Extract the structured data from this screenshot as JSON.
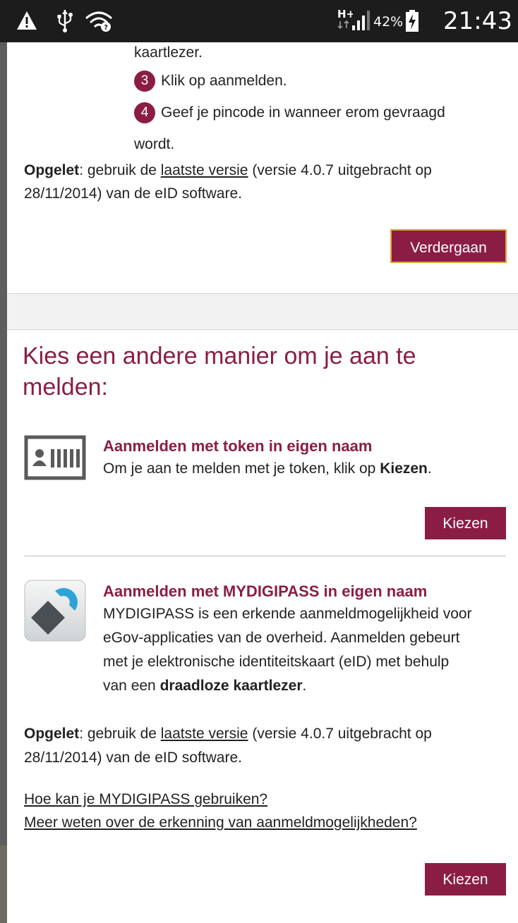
{
  "statusbar": {
    "icons": [
      "warning-icon",
      "usb-icon",
      "wifi-icon",
      "network-hplus-icon",
      "signal-icon",
      "battery-charging-icon"
    ],
    "network_type": "H+",
    "battery_percent": "42%",
    "time": "21:43"
  },
  "eid_section": {
    "step_cont_text": "kaartlezer.",
    "steps": [
      {
        "number": "3",
        "text": "Klik op aanmelden."
      },
      {
        "number": "4",
        "text": "Geef je pincode in wanneer erom gevraagd",
        "text_cont": "wordt."
      }
    ],
    "warning": {
      "label": "Opgelet",
      "text_before_link": ": gebruik de ",
      "link": "laatste versie",
      "text_after_link": " (versie 4.0.7 uitgebracht op",
      "text_line2": "28/11/2014) van de eID software."
    },
    "continue_button": "Verdergaan"
  },
  "other_methods": {
    "heading_line1": "Kies een andere manier om je aan te",
    "heading_line2": "melden:",
    "options": [
      {
        "icon": "id-card-icon",
        "title": "Aanmelden met token in eigen naam",
        "text_before": "Om je aan te melden met je token, klik op ",
        "text_bold": "Kiezen",
        "text_after": ".",
        "button": "Kiezen"
      },
      {
        "icon": "mydigipass-icon",
        "title": "Aanmelden met MYDIGIPASS in eigen naam",
        "lines": [
          "MYDIGIPASS is een erkende aanmeldmogelijkheid voor",
          "eGov-applicaties van de overheid. Aanmelden gebeurt",
          "met je elektronische identiteitskaart (eID) met behulp"
        ],
        "last_line_before": "van een ",
        "last_line_bold": "draadloze kaartlezer",
        "last_line_after": ".",
        "warning": {
          "label": "Opgelet",
          "text_before_link": ": gebruik de ",
          "link": "laatste versie",
          "text_after_link": " (versie 4.0.7 uitgebracht op",
          "text_line2": "28/11/2014) van de eID software."
        },
        "link_howto": "Hoe kan je MYDIGIPASS gebruiken?",
        "link_recognition": "Meer weten over de erkenning van aanmeldmogelijkheden?",
        "button": "Kiezen"
      }
    ]
  },
  "colors": {
    "accent": "#8b1d45",
    "button_focus_border": "#e3a43a"
  }
}
